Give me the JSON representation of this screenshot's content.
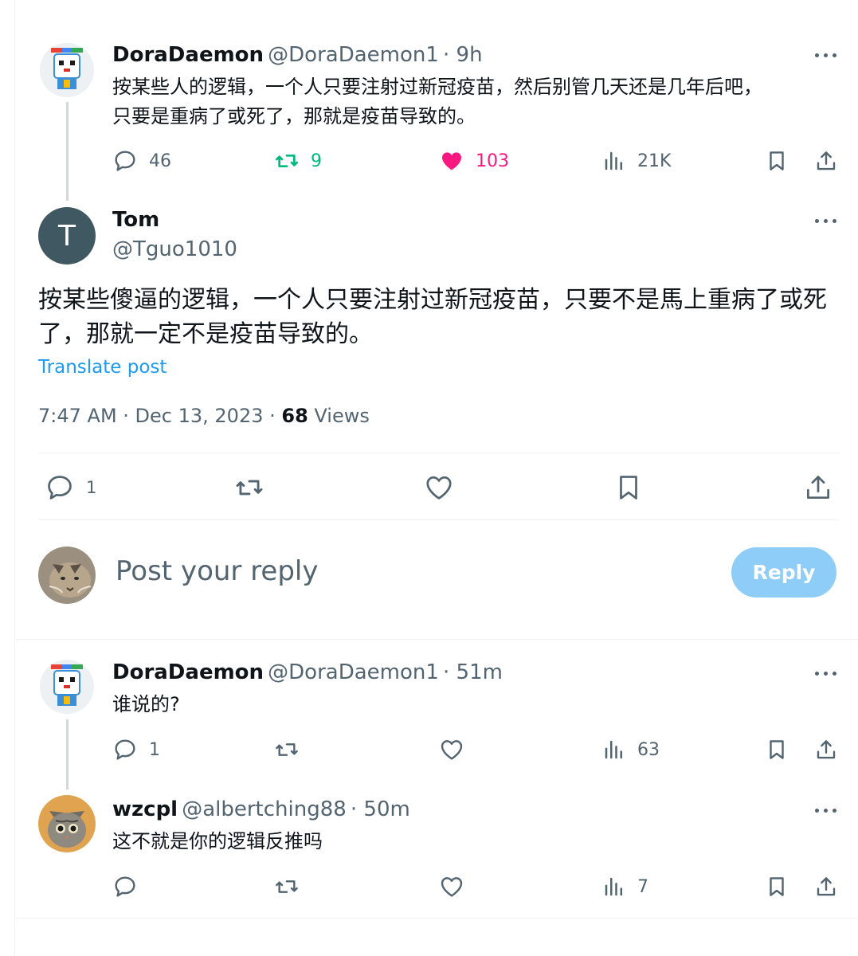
{
  "colors": {
    "retweet_green": "#00ba7c",
    "like_pink": "#f91880",
    "link_blue": "#1d9bf0",
    "reply_button_bg": "#8ecdf8",
    "muted": "#536471"
  },
  "tweets": [
    {
      "name": "DoraDaemon",
      "handle": "@DoraDaemon1",
      "time": "· 9h",
      "lines": [
        "按某些人的逻辑，一个人只要注射过新冠疫苗，然后别管几天还是几年后吧，",
        "只要是重病了或死了，那就是疫苗导致的。"
      ],
      "replies": "46",
      "retweets": "9",
      "likes": "103",
      "views": "21K"
    }
  ],
  "main_post": {
    "avatar_letter": "T",
    "name": "Tom",
    "handle": "@Tguo1010",
    "lines": [
      "按某些傻逼的逻辑，一个人只要注射过新冠疫苗，只要不是馬上重病了或死",
      "了，那就一定不是疫苗导致的。"
    ],
    "translate": "Translate post",
    "timestamp": "7:47 AM · Dec 13, 2023 · ",
    "views_count": "68",
    "views_label": " Views",
    "replies": "1"
  },
  "composer": {
    "placeholder": "Post your reply",
    "button": "Reply"
  },
  "replies": [
    {
      "name": "DoraDaemon",
      "handle": "@DoraDaemon1",
      "time": "· 51m",
      "text": "谁说的?",
      "replies": "1",
      "views": "63"
    },
    {
      "name": "wzcpl",
      "handle": "@albertching88",
      "time": "· 50m",
      "text": "这不就是你的逻辑反推吗",
      "views": "7"
    }
  ]
}
